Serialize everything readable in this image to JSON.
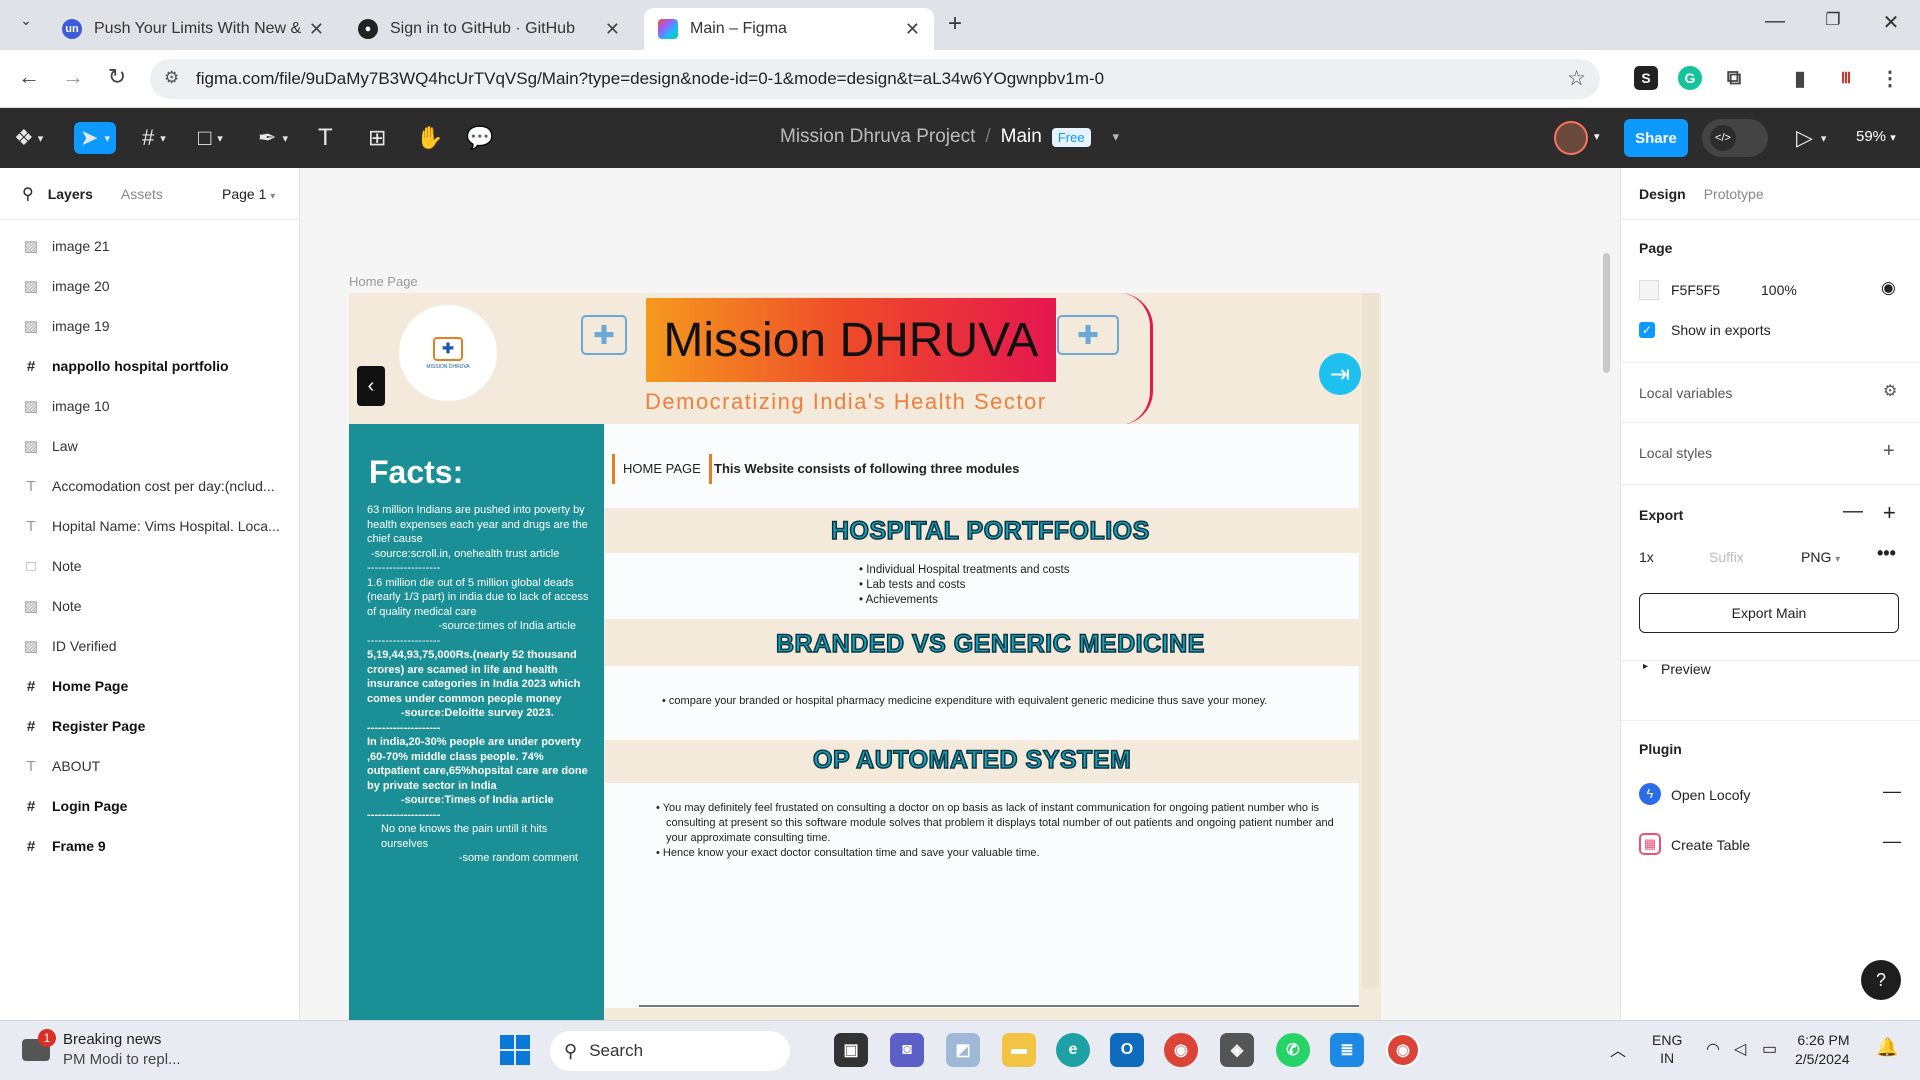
{
  "browser": {
    "tabs": [
      {
        "label": "Push Your Limits With New & U",
        "icon": "unacademy-icon"
      },
      {
        "label": "Sign in to GitHub · GitHub",
        "icon": "github-icon"
      },
      {
        "label": "Main – Figma",
        "icon": "figma-icon"
      }
    ],
    "url": "figma.com/file/9uDaMy7B3WQ4hcUrTVqVSg/Main?type=design&node-id=0-1&mode=design&t=aL34w6YOgwnpbv1m-0"
  },
  "figma": {
    "project": "Mission Dhruva Project",
    "file": "Main",
    "plan_badge": "Free",
    "share_label": "Share",
    "zoom": "59%"
  },
  "left_panel": {
    "tabs": [
      "Layers",
      "Assets"
    ],
    "page_selector": "Page 1",
    "layers": [
      {
        "name": "image 21",
        "type": "image"
      },
      {
        "name": "image 20",
        "type": "image"
      },
      {
        "name": "image 19",
        "type": "image"
      },
      {
        "name": "nappollo hospital portfolio",
        "type": "frame"
      },
      {
        "name": "image 10",
        "type": "image"
      },
      {
        "name": "Law",
        "type": "image"
      },
      {
        "name": "Accomodation cost per day:(nclud...",
        "type": "text"
      },
      {
        "name": "Hopital Name: Vims Hospital. Loca...",
        "type": "text"
      },
      {
        "name": "Note",
        "type": "rect"
      },
      {
        "name": "Note",
        "type": "image"
      },
      {
        "name": "ID Verified",
        "type": "image"
      },
      {
        "name": "Home Page",
        "type": "frame"
      },
      {
        "name": "Register Page",
        "type": "frame"
      },
      {
        "name": "ABOUT",
        "type": "text"
      },
      {
        "name": "Login Page",
        "type": "frame"
      },
      {
        "name": "Frame 9",
        "type": "frame"
      }
    ]
  },
  "right_panel": {
    "tabs": [
      "Design",
      "Prototype"
    ],
    "page_title": "Page",
    "page_color": "F5F5F5",
    "page_opacity": "100%",
    "show_in_exports": "Show in exports",
    "local_variables": "Local variables",
    "local_styles": "Local styles",
    "export_title": "Export",
    "export_scale": "1x",
    "export_suffix_placeholder": "Suffix",
    "export_format": "PNG",
    "export_button": "Export Main",
    "preview": "Preview",
    "plugin_title": "Plugin",
    "plugins": [
      "Open Locofy",
      "Create Table"
    ]
  },
  "design": {
    "frame_label": "Home Page",
    "title": "Mission DHRUVA",
    "tagline": "Democratizing India's Health Sector",
    "logo_text": "MISSION DHRUVA",
    "nav_home": "HOME PAGE",
    "nav_desc": "This Website consists of following three modules",
    "facts_title": "Facts:",
    "facts": [
      {
        "text": "63 million Indians are pushed into poverty by health expenses each year and drugs are the chief cause",
        "source": "-source:scroll.in, onehealth trust article",
        "bold": false
      },
      {
        "text": "1.6 million  die out of 5 million global deads (nearly 1/3 part) in india due to lack of access of quality medical care",
        "source": "-source:times of India article",
        "bold": false
      },
      {
        "text": "5,19,44,93,75,000Rs.(nearly 52 thousand crores) are scamed in life and health insurance categories in India 2023 which comes under common people money",
        "source": "-source:Deloitte survey 2023.",
        "bold": true
      },
      {
        "text": "In india,20-30% people are under poverty ,60-70% middle class people. 74% outpatient care,65%hopsital care are done by private sector in India",
        "source": "-source:Times of India article",
        "bold": true
      },
      {
        "text": "No one knows the pain untill it hits ourselves",
        "source": "-some random comment",
        "bold": false
      }
    ],
    "divider": "--------------------",
    "modules": [
      {
        "title": "HOSPITAL PORTFFOLIOS",
        "bullets": [
          "Individual Hospital treatments and costs",
          "Lab tests and costs",
          "Achievements"
        ]
      },
      {
        "title": "BRANDED VS GENERIC MEDICINE",
        "bullets": [
          "compare your branded or hospital pharmacy medicine expenditure with equivalent generic medicine thus save your money."
        ]
      },
      {
        "title": "OP AUTOMATED SYSTEM",
        "bullets": [
          "You may definitely feel frustated on consulting a doctor on op basis as lack of  instant communication for ongoing patient number who is consulting at present so this software module solves that problem it displays total number of out patients and ongoing patient number and your approximate consulting time.",
          "Hence know your exact doctor consultation time and save your valuable time."
        ]
      }
    ]
  },
  "taskbar": {
    "news_title": "Breaking news",
    "news_sub": "PM Modi to repl...",
    "news_badge": "1",
    "search": "Search",
    "lang1": "ENG",
    "lang2": "IN",
    "time": "6:26 PM",
    "date": "2/5/2024"
  }
}
